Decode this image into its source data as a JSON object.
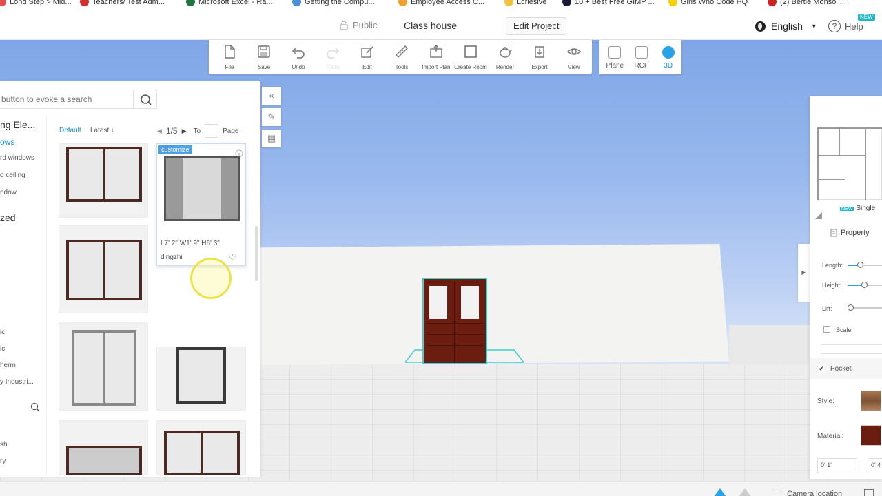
{
  "bookmarks": [
    {
      "label": "Lond Step > Mid...",
      "color": "#e05050"
    },
    {
      "label": "Teachers/ Test Adm...",
      "color": "#d32f2f"
    },
    {
      "label": "Microsoft Excel - Ra...",
      "color": "#217346"
    },
    {
      "label": "Getting the Compu...",
      "color": "#4a90d9"
    },
    {
      "label": "Employee Access C...",
      "color": "#f0a030"
    },
    {
      "label": "Lcrieslve",
      "color": "#f0c040"
    },
    {
      "label": "10 + Best Free GIMP ...",
      "color": "#1a1a3a"
    },
    {
      "label": "Girls Who Code HQ",
      "color": "#f5d000"
    },
    {
      "label": "(2) Bertie Monsoi ...",
      "color": "#cc2222"
    }
  ],
  "header": {
    "visibility": "Public",
    "project_name": "Class house",
    "edit_button": "Edit Project",
    "language": "English",
    "help": "Help",
    "new_badge": "NEW"
  },
  "toolbar": {
    "tools": [
      {
        "label": "File",
        "icon": "file-icon",
        "enabled": true
      },
      {
        "label": "Save",
        "icon": "save-icon",
        "enabled": true
      },
      {
        "label": "Undo",
        "icon": "undo-icon",
        "enabled": true
      },
      {
        "label": "Redo",
        "icon": "redo-icon",
        "enabled": false
      },
      {
        "label": "Edit",
        "icon": "edit-icon",
        "enabled": true
      },
      {
        "label": "Tools",
        "icon": "ruler-icon",
        "enabled": true
      },
      {
        "label": "Import Plan",
        "icon": "import-plan-icon",
        "enabled": true
      },
      {
        "label": "Create Room",
        "icon": "create-room-icon",
        "enabled": true
      },
      {
        "label": "Render",
        "icon": "teapot-icon",
        "enabled": true
      },
      {
        "label": "Export",
        "icon": "export-icon",
        "enabled": true
      },
      {
        "label": "View",
        "icon": "eye-icon",
        "enabled": true
      }
    ],
    "view_modes": [
      {
        "label": "Plane",
        "icon": "plane-icon",
        "active": false
      },
      {
        "label": "RCP",
        "icon": "rcp-icon",
        "active": false
      },
      {
        "label": "3D",
        "icon": "cube-icon",
        "active": true
      }
    ]
  },
  "catalog": {
    "search_placeholder": "button to evoke a search",
    "categories": [
      {
        "label": "ng Ele...",
        "style": "big"
      },
      {
        "label": "ows",
        "style": "active"
      },
      {
        "label": "rd windows",
        "style": "normal"
      },
      {
        "label": "o ceiling",
        "style": "normal"
      },
      {
        "label": "ndow",
        "style": "normal"
      },
      {
        "label": "zed",
        "style": "big"
      },
      {
        "label": "ic",
        "style": "normal"
      },
      {
        "label": "ic",
        "style": "normal"
      },
      {
        "label": "herm",
        "style": "normal"
      },
      {
        "label": "y Industri...",
        "style": "normal"
      },
      {
        "label": "sh",
        "style": "normal"
      },
      {
        "label": "ry",
        "style": "normal"
      }
    ],
    "sort_default": "Default",
    "sort_latest": "Latest",
    "pager": {
      "current": "1/5",
      "to": "To",
      "page": "Page"
    },
    "hover_card": {
      "tag": "customize",
      "dims": "L7' 2\" W1' 9\" H6' 3\"",
      "author": "dingzhi"
    }
  },
  "properties": {
    "single_tab": "Single",
    "title": "Property",
    "length": "Length:",
    "height": "Height:",
    "lift": "Lift:",
    "scale": "Scale",
    "pocket": "Pocket",
    "style": "Style:",
    "material": "Material:",
    "dim1": "0' 1\"",
    "dim2": "0' 4"
  },
  "status": {
    "camera_location": "Camera location"
  },
  "colors": {
    "accent": "#27a2e6",
    "selection": "#3ecfd2",
    "door": "#6b1d10"
  }
}
